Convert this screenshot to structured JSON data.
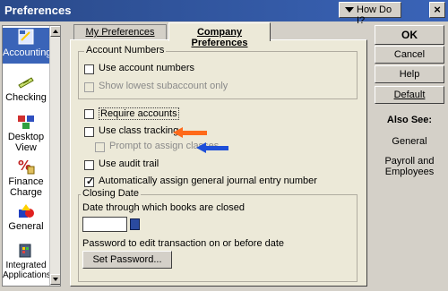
{
  "window": {
    "title": "Preferences",
    "how_do_i": "How Do I?",
    "close": "×"
  },
  "sidebar": {
    "items": [
      {
        "label": "Accounting",
        "icon": "accounting-icon",
        "selected": true
      },
      {
        "label": "Checking",
        "icon": "checking-icon",
        "selected": false
      },
      {
        "label": "Desktop View",
        "icon": "desktop-view-icon",
        "selected": false
      },
      {
        "label": "Finance Charge",
        "icon": "finance-charge-icon",
        "selected": false
      },
      {
        "label": "General",
        "icon": "general-icon",
        "selected": false
      },
      {
        "label": "Integrated Applications",
        "icon": "integrated-applications-icon",
        "selected": false
      }
    ]
  },
  "tabs": {
    "my_prefs": "My Preferences",
    "company_prefs": "Company Preferences"
  },
  "account_numbers": {
    "group_title": "Account Numbers",
    "use_numbers": "Use account numbers",
    "show_lowest": "Show lowest subaccount only"
  },
  "options": {
    "require_accounts": "Require accounts",
    "use_class_tracking": "Use class tracking",
    "prompt_assign_classes": "Prompt to assign classes",
    "use_audit_trail": "Use audit trail",
    "auto_assign_journal": "Automatically assign general journal entry number"
  },
  "closing_date": {
    "group_title": "Closing Date",
    "through_label": "Date through which books are closed",
    "date_value": "",
    "password_label": "Password to edit transaction on or before date",
    "set_password": "Set Password..."
  },
  "buttons": {
    "ok": "OK",
    "cancel": "Cancel",
    "help": "Help",
    "default": "Default"
  },
  "also_see": {
    "heading": "Also See:",
    "links": [
      "General",
      "Payroll and Employees"
    ]
  },
  "colors": {
    "orange_arrow": "#ff6a1a",
    "blue_arrow": "#1e4fd8",
    "title_bar": "#2a4a8a"
  }
}
